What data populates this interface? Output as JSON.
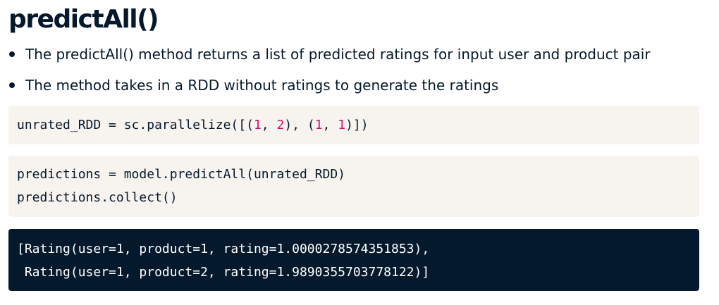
{
  "title": "predictAll()",
  "bullets": [
    "The predictAll() method returns a list of predicted ratings for input user and product pair",
    "The method takes in a RDD without ratings to generate the ratings"
  ],
  "code_block_1": {
    "line1": {
      "p1": "unrated_RDD = sc.parallelize([(",
      "n1": "1",
      "p2": ", ",
      "n2": "2",
      "p3": "), (",
      "n3": "1",
      "p4": ", ",
      "n4": "1",
      "p5": ")])"
    }
  },
  "code_block_2": {
    "lines": [
      "predictions = model.predictAll(unrated_RDD)",
      "predictions.collect()"
    ]
  },
  "output_block": {
    "lines": [
      "[Rating(user=1, product=1, rating=1.0000278574351853),",
      " Rating(user=1, product=2, rating=1.9890355703778122)]"
    ]
  },
  "colors": {
    "text": "#05192d",
    "code_bg": "#f7f3ee",
    "output_bg": "#05192d",
    "number": "#d10f6d"
  }
}
